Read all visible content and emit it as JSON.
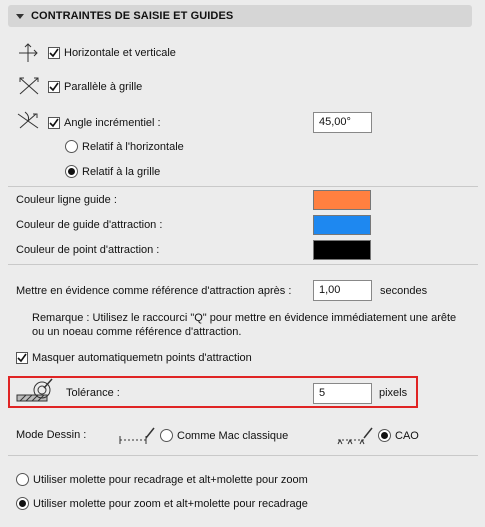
{
  "panel": {
    "title": "CONTRAINTES DE SAISIE ET GUIDES"
  },
  "constraints": {
    "horizontal_vertical": {
      "label": "Horizontale et verticale",
      "checked": true
    },
    "parallel_grid": {
      "label": "Parallèle à grille",
      "checked": true
    },
    "incremental_angle": {
      "label": "Angle incrémentiel :",
      "checked": true,
      "value": "45,00°"
    },
    "relative_horizontal": {
      "label": "Relatif à l'horizontale",
      "selected": false
    },
    "relative_grid": {
      "label": "Relatif à la grille",
      "selected": true
    }
  },
  "colors": {
    "guide_line": {
      "label": "Couleur ligne guide :",
      "color": "#ff8040"
    },
    "snap_guide": {
      "label": "Couleur de guide d'attraction :",
      "color": "#1e88f0"
    },
    "snap_point": {
      "label": "Couleur de point d'attraction :",
      "color": "#000000"
    }
  },
  "highlight": {
    "label": "Mettre en évidence comme référence d'attraction après :",
    "value": "1,00",
    "unit": "secondes",
    "remark_line1": "Remarque : Utilisez le raccourci \"Q\" pour mettre en évidence immédiatement une arête",
    "remark_line2": "ou un noeau comme référence d'attraction."
  },
  "auto_hide": {
    "label": "Masquer automatiquemetn points d'attraction",
    "checked": true
  },
  "tolerance": {
    "label": "Tolérance :",
    "value": "5",
    "unit": "pixels"
  },
  "draw_mode": {
    "label": "Mode Dessin :",
    "mac_classic": {
      "label": "Comme Mac classique",
      "selected": false
    },
    "cad": {
      "label": "CAO",
      "selected": true
    }
  },
  "wheel": {
    "option1": {
      "label": "Utiliser molette pour recadrage et alt+molette pour zoom",
      "selected": false
    },
    "option2": {
      "label": "Utiliser molette pour zoom et alt+molette pour recadrage",
      "selected": true
    }
  }
}
